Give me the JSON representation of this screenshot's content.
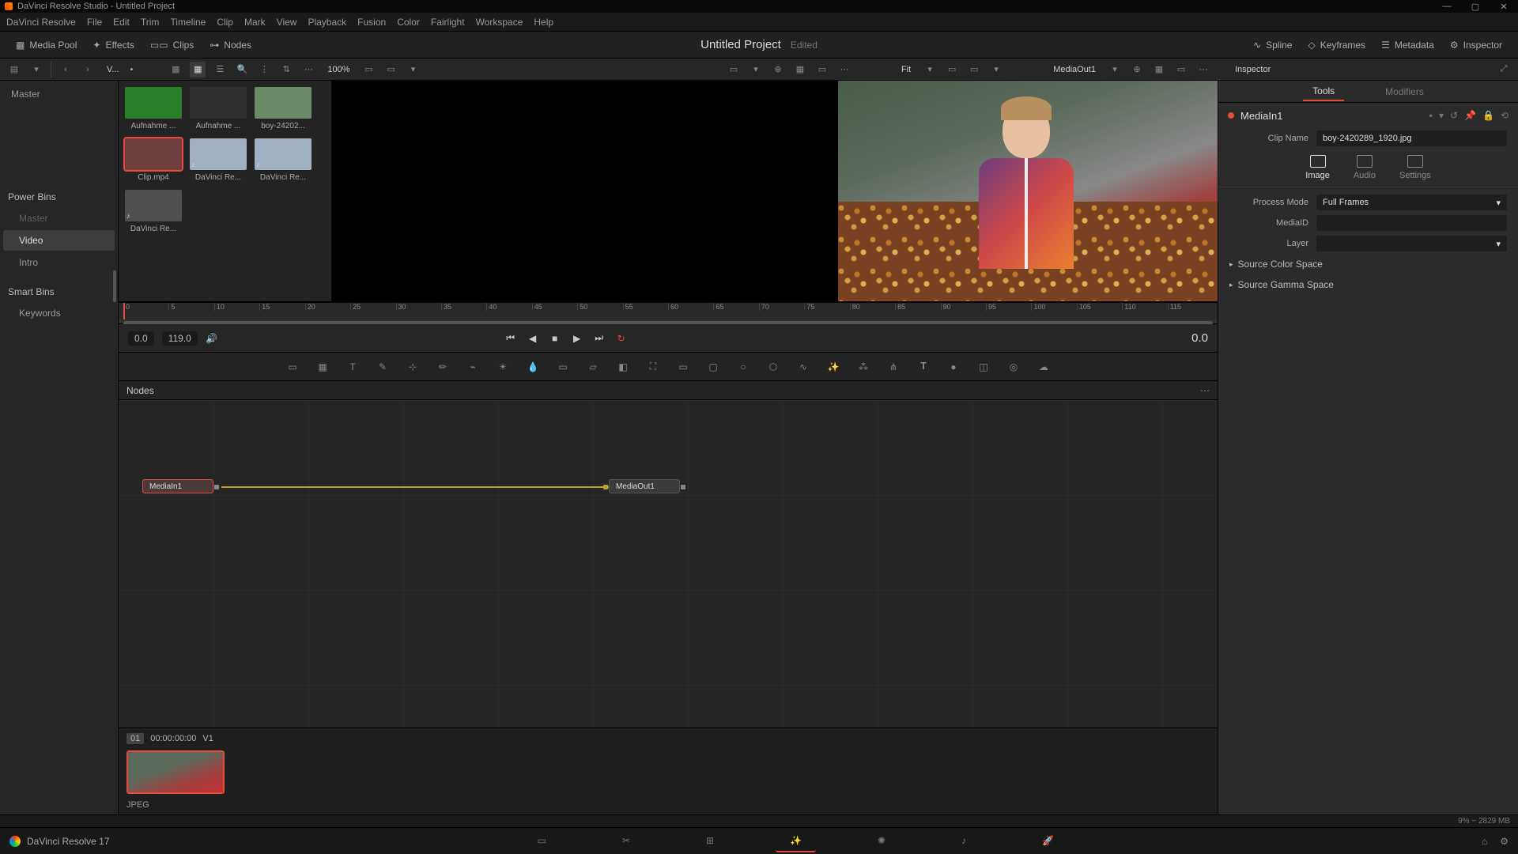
{
  "titlebar": {
    "text": "DaVinci Resolve Studio - Untitled Project"
  },
  "menubar": [
    "DaVinci Resolve",
    "File",
    "Edit",
    "Trim",
    "Timeline",
    "Clip",
    "Mark",
    "View",
    "Playback",
    "Fusion",
    "Color",
    "Fairlight",
    "Workspace",
    "Help"
  ],
  "mainToolbar": {
    "mediaPool": "Media Pool",
    "effects": "Effects",
    "clips": "Clips",
    "nodes": "Nodes",
    "spline": "Spline",
    "keyframes": "Keyframes",
    "metadata": "Metadata",
    "inspector": "Inspector"
  },
  "project": {
    "name": "Untitled Project",
    "edited": "Edited"
  },
  "subToolbar": {
    "zoom": "100%",
    "sortLabel": "V...",
    "fit": "Fit",
    "viewerNode": "MediaOut1"
  },
  "leftPanel": {
    "master": "Master",
    "powerBins": "Power Bins",
    "binItems": [
      "Master",
      "Video",
      "Intro"
    ],
    "smartBins": "Smart Bins",
    "keywords": "Keywords"
  },
  "media": [
    {
      "label": "Aufnahme ...",
      "color": "#2a802a",
      "sel": false
    },
    {
      "label": "Aufnahme ...",
      "color": "#303030",
      "sel": false
    },
    {
      "label": "boy-24202...",
      "color": "#6a8a6a",
      "sel": false
    },
    {
      "label": "Clip.mp4",
      "color": "#704040",
      "sel": true
    },
    {
      "label": "DaVinci Re...",
      "color": "#a0b0c0",
      "sel": false,
      "audio": true
    },
    {
      "label": "DaVinci Re...",
      "color": "#a0b0c0",
      "sel": false,
      "audio": true
    },
    {
      "label": "DaVinci Re...",
      "color": "#505050",
      "sel": false,
      "audio": true
    }
  ],
  "ruler": [
    "0",
    "5",
    "10",
    "15",
    "20",
    "25",
    "30",
    "35",
    "40",
    "45",
    "50",
    "55",
    "60",
    "65",
    "70",
    "75",
    "80",
    "85",
    "90",
    "95",
    "100",
    "105",
    "110",
    "115"
  ],
  "transport": {
    "in": "0.0",
    "out": "119.0",
    "right": "0.0"
  },
  "nodes": {
    "title": "Nodes",
    "a": "MediaIn1",
    "b": "MediaOut1"
  },
  "clipRow": {
    "num": "01",
    "tc": "00:00:00:00",
    "track": "V1",
    "codec": "JPEG"
  },
  "inspector": {
    "title": "Inspector",
    "tabs": {
      "tools": "Tools",
      "modifiers": "Modifiers"
    },
    "nodeName": "MediaIn1",
    "clipNameLabel": "Clip Name",
    "clipName": "boy-2420289_1920.jpg",
    "propTabs": {
      "image": "Image",
      "audio": "Audio",
      "settings": "Settings"
    },
    "processModeLabel": "Process Mode",
    "processMode": "Full Frames",
    "mediaIdLabel": "MediaID",
    "layerLabel": "Layer",
    "sourceColor": "Source Color Space",
    "sourceGamma": "Source Gamma Space"
  },
  "status": {
    "mem": "9% ~ 2829 MB"
  },
  "pageBar": {
    "brand": "DaVinci Resolve 17"
  }
}
